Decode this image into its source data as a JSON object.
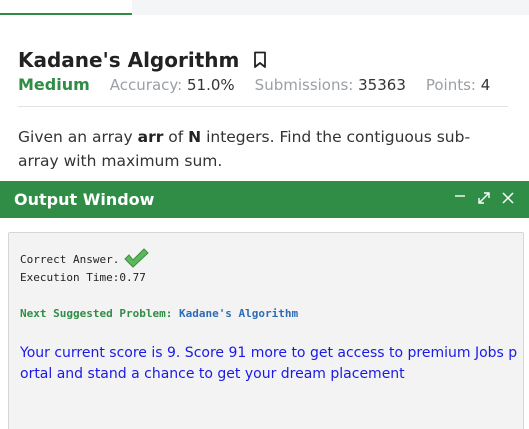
{
  "problem": {
    "title": "Kadane's Algorithm",
    "difficulty": "Medium",
    "accuracy_label": "Accuracy:",
    "accuracy_value": "51.0%",
    "submissions_label": "Submissions:",
    "submissions_value": "35363",
    "points_label": "Points:",
    "points_value": "4",
    "description": {
      "part1": "Given an array ",
      "arr": "arr",
      "part2": " of ",
      "n": "N",
      "part3": " integers. Find the contiguous sub-array with maximum sum."
    }
  },
  "output_window": {
    "title": "Output Window",
    "controls": {
      "minimize_icon": "minimize-icon",
      "expand_icon": "expand-icon",
      "close_icon": "close-icon"
    },
    "correct_text": "Correct Answer.",
    "execution_time": "Execution Time:0.77",
    "next_label": "Next Suggested Problem:",
    "next_problem": "Kadane's Algorithm",
    "score_message": "Your current score is 9. Score 91 more to get access to premium Jobs portal and stand a chance to get your dream placement"
  },
  "colors": {
    "brand_green": "#2f8d46",
    "link_blue": "#2e6db4",
    "message_blue": "#1a1ae6"
  }
}
